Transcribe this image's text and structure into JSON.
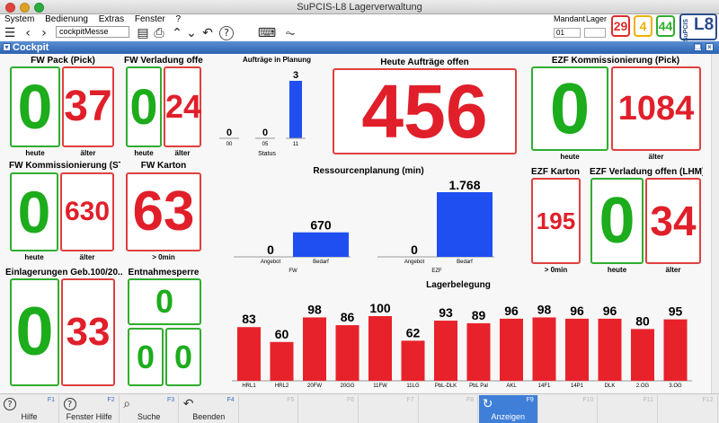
{
  "window": {
    "title": "SuPCIS-L8 Lagerverwaltung"
  },
  "menu": [
    "System",
    "Bedienung",
    "Extras",
    "Fenster",
    "?"
  ],
  "toolbar": {
    "search_value": "cockpitMesse",
    "icons": [
      "menu-icon",
      "back-icon",
      "forward-icon",
      "save-icon",
      "print-icon",
      "up-icon",
      "down-icon",
      "undo-icon",
      "help-icon",
      "keyboard-icon",
      "pulse-icon"
    ]
  },
  "mandant": {
    "label": "Mandant",
    "value": "01",
    "lager_label": "Lager",
    "lager_value": ""
  },
  "badges": [
    {
      "value": "29",
      "color": "#e02b2b"
    },
    {
      "value": "4",
      "color": "#f0b000"
    },
    {
      "value": "44",
      "color": "#2fae2f"
    }
  ],
  "logo": {
    "small": "SuPCIS",
    "big": "L8"
  },
  "cockpit": {
    "title": "Cockpit"
  },
  "widgets": {
    "fw_pack": {
      "title": "FW Pack (Pick)",
      "heute": "0",
      "aelter": "37",
      "cap_heute": "heute",
      "cap_aelter": "älter"
    },
    "fw_verladung": {
      "title": "FW Verladung offe...",
      "heute": "0",
      "aelter": "24",
      "cap_heute": "heute",
      "cap_aelter": "älter"
    },
    "fw_komm": {
      "title": "FW Kommissionierung (ST...",
      "heute": "0",
      "aelter": "630",
      "cap_heute": "heute",
      "cap_aelter": "älter"
    },
    "fw_karton": {
      "title": "FW Karton",
      "value": "63",
      "cap": "> 0min"
    },
    "einlagerungen": {
      "title": "Einlagerungen Geb.100/20...",
      "heute": "0",
      "aelter": "33"
    },
    "entnahmesperre": {
      "title": "Entnahmesperre",
      "top": "0",
      "left": "0",
      "right": "0"
    },
    "heute_auftraege": {
      "title": "Heute Aufträge offen",
      "value": "456"
    },
    "ezf_komm": {
      "title": "EZF Kommissionierung (Pick)",
      "heute": "0",
      "aelter": "1084",
      "cap_heute": "heute",
      "cap_aelter": "älter"
    },
    "ezf_karton": {
      "title": "EZF Karton",
      "value": "195",
      "cap": "> 0min"
    },
    "ezf_verladung": {
      "title": "EZF Verladung offen (LHM)",
      "heute": "0",
      "aelter": "34",
      "cap_heute": "heute",
      "cap_aelter": "älter"
    },
    "auftraege_planung": {
      "title": "Aufträge in Planung",
      "xlabel": "Status"
    },
    "ressourcen": {
      "title": "Ressourcenplanung (min)"
    },
    "lagerbelegung": {
      "title": "Lagerbelegung"
    }
  },
  "chart_data": [
    {
      "type": "bar",
      "title": "Aufträge in Planung",
      "categories": [
        "00",
        "05",
        "11"
      ],
      "values": [
        0,
        0,
        3
      ],
      "xlabel": "Status",
      "ylim": [
        0,
        3
      ]
    },
    {
      "type": "bar",
      "title": "Ressourcenplanung (min)",
      "groups": [
        {
          "name": "FW",
          "categories": [
            "Angebot",
            "Bedarf"
          ],
          "values": [
            0,
            670
          ]
        },
        {
          "name": "EZF",
          "categories": [
            "Angebot",
            "Bedarf"
          ],
          "values": [
            0,
            1768
          ],
          "value_labels": [
            "0",
            "1.768"
          ]
        }
      ],
      "ylim": [
        0,
        1768
      ]
    },
    {
      "type": "bar",
      "title": "Lagerbelegung",
      "categories": [
        "HRL1",
        "HRL2",
        "20FW",
        "20GG",
        "11FW",
        "11LG",
        "PbL-DLK",
        "PbL Pal",
        "AKL",
        "14F1",
        "14P1",
        "DLK",
        "2.OG",
        "3.OG"
      ],
      "values": [
        83,
        60,
        98,
        86,
        100,
        62,
        93,
        89,
        96,
        98,
        96,
        96,
        80,
        95
      ],
      "ylim": [
        0,
        100
      ]
    }
  ],
  "fkeys": [
    {
      "num": "F1",
      "label": "Hilfe",
      "icon": "help-icon"
    },
    {
      "num": "F2",
      "label": "Fenster Hilfe",
      "icon": "help-icon"
    },
    {
      "num": "F3",
      "label": "Suche",
      "icon": "search-icon"
    },
    {
      "num": "F4",
      "label": "Beenden",
      "icon": "exit-icon"
    },
    {
      "num": "F5",
      "label": ""
    },
    {
      "num": "F6",
      "label": ""
    },
    {
      "num": "F7",
      "label": ""
    },
    {
      "num": "F8",
      "label": ""
    },
    {
      "num": "F9",
      "label": "Anzeigen",
      "icon": "refresh-icon",
      "active": true
    },
    {
      "num": "F10",
      "label": ""
    },
    {
      "num": "F11",
      "label": ""
    },
    {
      "num": "F12",
      "label": ""
    }
  ]
}
